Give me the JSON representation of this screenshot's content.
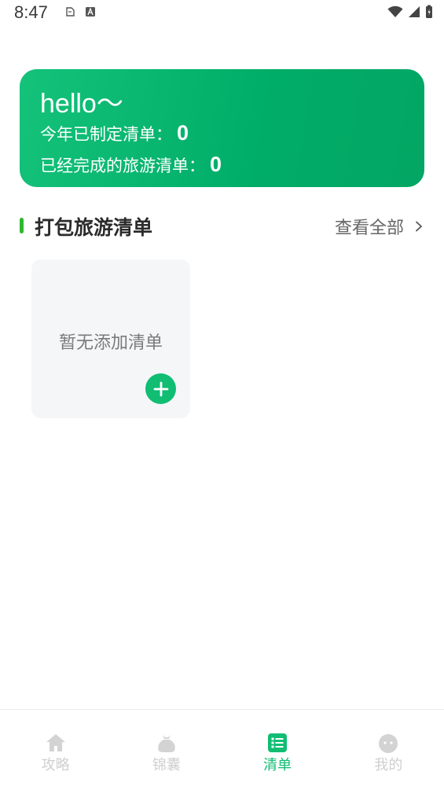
{
  "status_bar": {
    "time": "8:47"
  },
  "hero": {
    "greeting": "hello～",
    "planned_label": "今年已制定清单：",
    "planned_count": "0",
    "completed_label": "已经完成的旅游清单：",
    "completed_count": "0",
    "gradient_colors": [
      "#14c27a",
      "#03a664"
    ]
  },
  "section": {
    "title": "打包旅游清单",
    "view_all": "查看全部",
    "accent_color": "#2db82d"
  },
  "empty_card": {
    "text": "暂无添加清单",
    "add_icon": "plus-icon"
  },
  "tabs": [
    {
      "label": "攻略",
      "icon": "home-icon",
      "active": false
    },
    {
      "label": "锦囊",
      "icon": "bag-icon",
      "active": false
    },
    {
      "label": "清单",
      "icon": "list-icon",
      "active": true
    },
    {
      "label": "我的",
      "icon": "profile-icon",
      "active": false
    }
  ],
  "colors": {
    "brand": "#10bd73",
    "tab_inactive": "#cfcfcf"
  }
}
